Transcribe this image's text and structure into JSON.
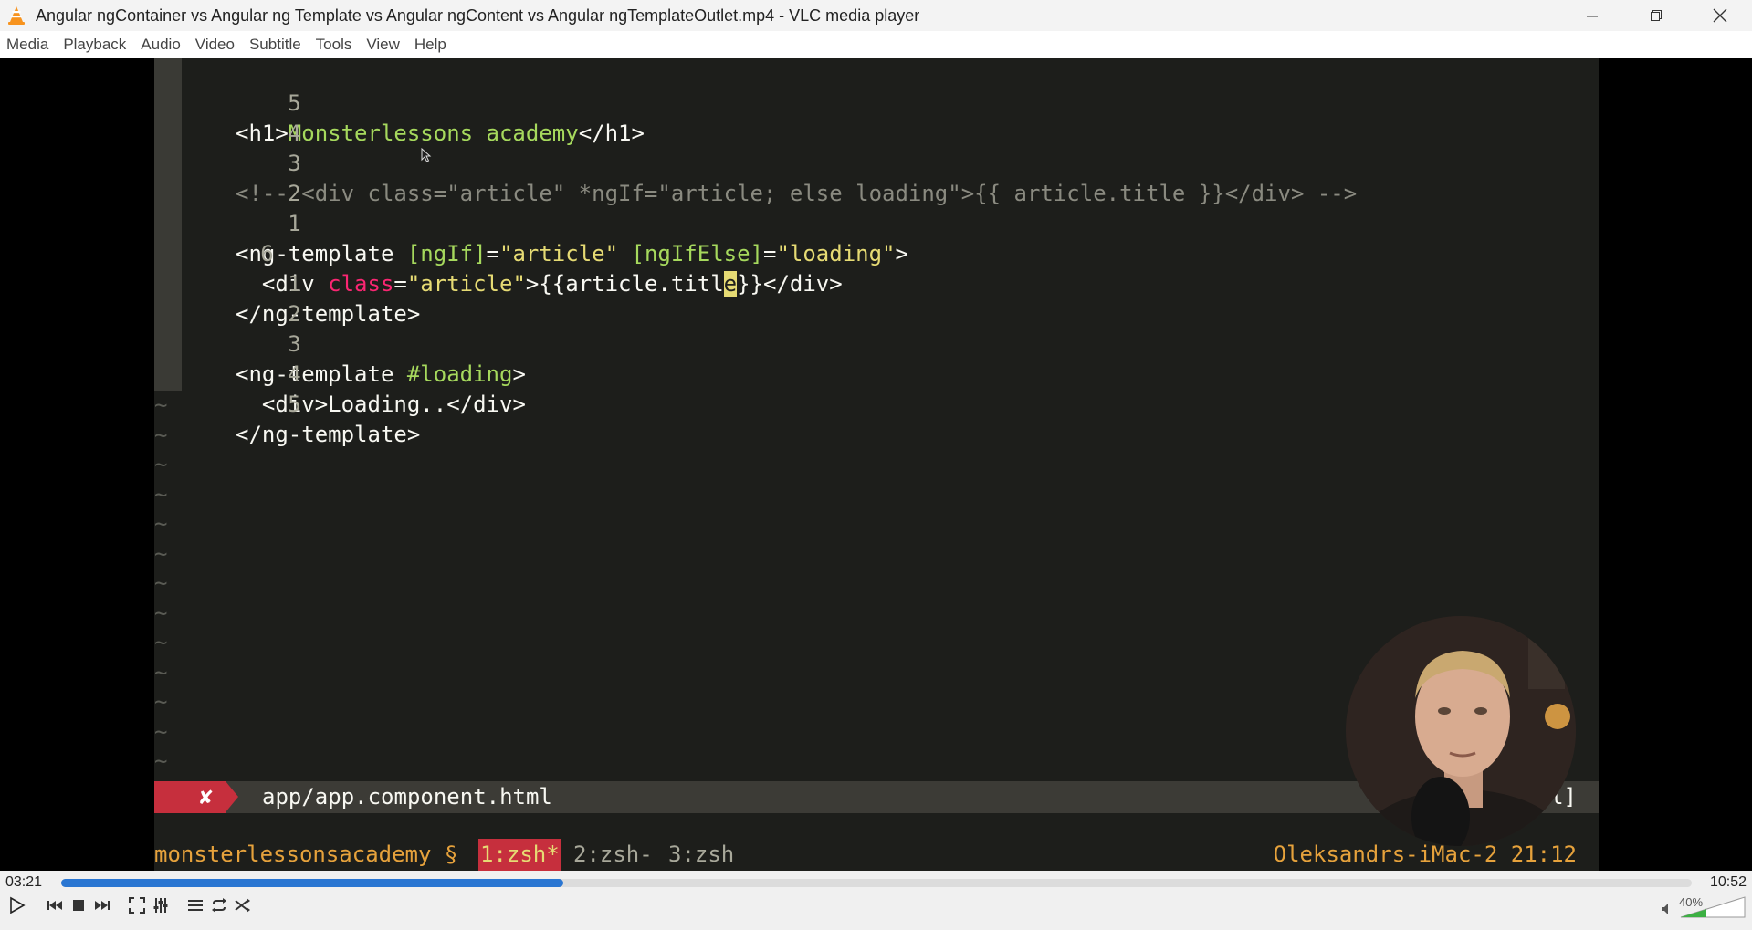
{
  "window": {
    "title": "Angular ngContainer vs Angular ng Template vs Angular ngContent vs Angular ngTemplateOutlet.mp4 - VLC media player"
  },
  "menu": [
    "Media",
    "Playback",
    "Audio",
    "Video",
    "Subtitle",
    "Tools",
    "View",
    "Help"
  ],
  "editor": {
    "lines": [
      {
        "num": "5",
        "current": false
      },
      {
        "num": "4",
        "current": false
      },
      {
        "num": "3",
        "current": false
      },
      {
        "num": "2",
        "current": false
      },
      {
        "num": "1",
        "current": false
      },
      {
        "num": "6",
        "current": true
      },
      {
        "num": "1",
        "current": false
      },
      {
        "num": "2",
        "current": false
      },
      {
        "num": "3",
        "current": false
      },
      {
        "num": "4",
        "current": false
      },
      {
        "num": "5",
        "current": false
      }
    ],
    "tokens": {
      "l1": [
        "<h1>",
        "Monsterlessons academy",
        "</h1>"
      ],
      "l3": "<!-- <div class=\"article\" *ngIf=\"article; else loading\">{{ article.title }}</div> -->",
      "l5": [
        "<ng-template ",
        "[ngIf]",
        "=",
        "\"article\"",
        " ",
        "[ngIfElse]",
        "=",
        "\"loading\"",
        ">"
      ],
      "l6": [
        "  <div ",
        "class",
        "=",
        "\"article\"",
        ">{{article.titl",
        "e",
        "}}</div>"
      ],
      "l7": "</ng-template>",
      "l9": [
        "<ng-template ",
        "#loading",
        ">"
      ],
      "l10": [
        "  <div>",
        "Loading..",
        "</div>"
      ],
      "l11": "</ng-template>"
    },
    "tilde": "~",
    "status": {
      "error_mark": "✘",
      "file": "app/app.component.html",
      "right": "l]"
    },
    "tmux": {
      "session": "monsterlessonsacademy §",
      "active_window": "1:zsh*",
      "window2": "2:zsh-",
      "window3": "3:zsh",
      "host": "Oleksandrs-iMac-2",
      "clock": "21:12"
    }
  },
  "player": {
    "elapsed": "03:21",
    "total": "10:52",
    "progress": 0.308,
    "volume_label": "40%",
    "volume": 0.4
  },
  "colors": {
    "accent": "#2a76d2",
    "error": "#c62f3d",
    "tmux_text": "#e6a23c"
  }
}
